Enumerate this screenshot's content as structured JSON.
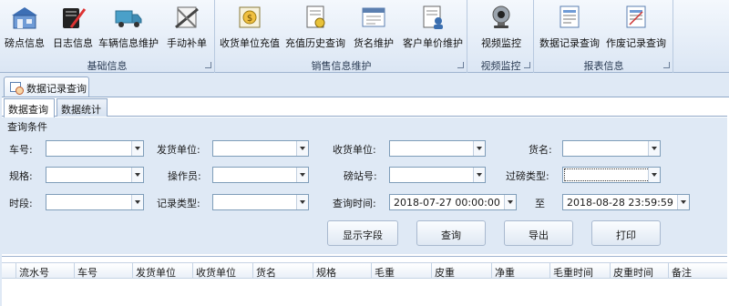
{
  "ribbon": {
    "groups": [
      {
        "label": "基础信息",
        "buttons": [
          {
            "label": "磅点信息",
            "icon": "warehouse-icon"
          },
          {
            "label": "日志信息",
            "icon": "notebook-pen-icon"
          },
          {
            "label": "车辆信息维护",
            "icon": "truck-icon"
          },
          {
            "label": "手动补单",
            "icon": "tools-icon"
          }
        ]
      },
      {
        "label": "销售信息维护",
        "buttons": [
          {
            "label": "收货单位充值",
            "icon": "recharge-icon"
          },
          {
            "label": "充值历史查询",
            "icon": "history-document-icon"
          },
          {
            "label": "货名维护",
            "icon": "goods-form-icon"
          },
          {
            "label": "客户单价维护",
            "icon": "customer-price-icon"
          }
        ]
      },
      {
        "label": "视频监控",
        "buttons": [
          {
            "label": "视频监控",
            "icon": "webcam-icon"
          }
        ]
      },
      {
        "label": "报表信息",
        "buttons": [
          {
            "label": "数据记录查询",
            "icon": "data-report-icon"
          },
          {
            "label": "作废记录查询",
            "icon": "void-report-icon"
          }
        ]
      }
    ]
  },
  "document_tab": {
    "label": "数据记录查询"
  },
  "inner_tabs": [
    {
      "label": "数据查询",
      "active": true
    },
    {
      "label": "数据统计",
      "active": false
    }
  ],
  "filter": {
    "title": "查询条件",
    "fields": {
      "plate": {
        "label": "车号:",
        "value": ""
      },
      "sender": {
        "label": "发货单位:",
        "value": ""
      },
      "receiver": {
        "label": "收货单位:",
        "value": ""
      },
      "goods": {
        "label": "货名:",
        "value": ""
      },
      "spec": {
        "label": "规格:",
        "value": ""
      },
      "operator": {
        "label": "操作员:",
        "value": ""
      },
      "station": {
        "label": "磅站号:",
        "value": ""
      },
      "weigh_type": {
        "label": "过磅类型:",
        "value": ""
      },
      "period": {
        "label": "时段:",
        "value": ""
      },
      "record_type": {
        "label": "记录类型:",
        "value": ""
      },
      "query_time": {
        "label": "查询时间:",
        "value": "2018-07-27 00:00:00"
      },
      "to": {
        "label": "至",
        "value": "2018-08-28 23:59:59"
      }
    },
    "buttons": {
      "show_fields": "显示字段",
      "query": "查询",
      "export": "导出",
      "print": "打印"
    }
  },
  "grid": {
    "columns": [
      "流水号",
      "车号",
      "发货单位",
      "收货单位",
      "货名",
      "规格",
      "毛重",
      "皮重",
      "净重",
      "毛重时间",
      "皮重时间",
      "备注"
    ],
    "rows": []
  }
}
